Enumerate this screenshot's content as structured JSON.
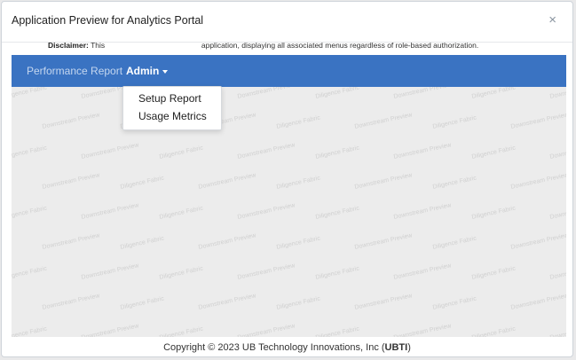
{
  "modal": {
    "title": "Application Preview for Analytics Portal",
    "close_label": "×"
  },
  "navbar": {
    "brand": "Performance Report",
    "user_menu": "Admin",
    "accent_color": "#3a73c2"
  },
  "dropdown": {
    "items": [
      {
        "label": "Setup Report"
      },
      {
        "label": "Usage Metrics"
      }
    ]
  },
  "disclaimer": {
    "label": "Disclaimer:",
    "text_start": "This",
    "text_end": "application, displaying all associated menus regardless of role-based authorization."
  },
  "watermark": {
    "text_a": "Diligence Fabric",
    "text_b": "Downstream Preview"
  },
  "footer": {
    "prefix": "Copyright © 2023 UB Technology Innovations, Inc (",
    "brand": "UBTI",
    "suffix": ")"
  }
}
